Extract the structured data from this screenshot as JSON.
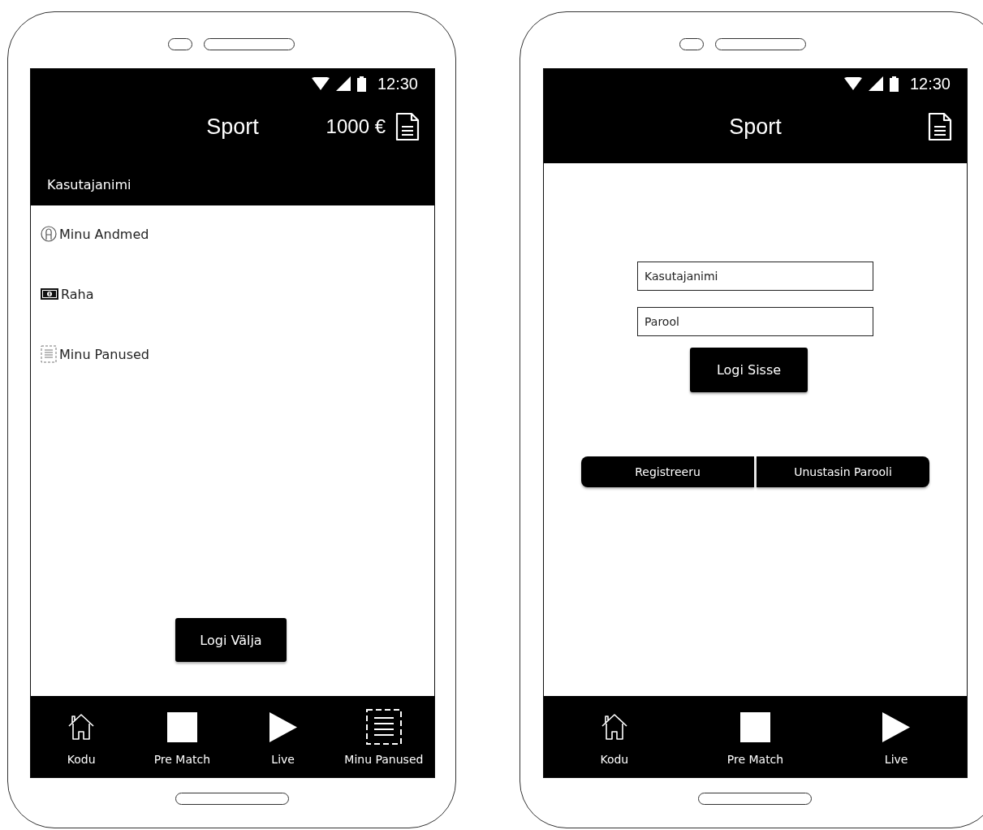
{
  "phones": [
    {
      "kind": "menu",
      "status_bar": {
        "time": "12:30"
      },
      "app_bar": {
        "title": "Sport",
        "balance": "1000 €"
      },
      "username": "Kasutajanimi",
      "menu_items": [
        {
          "kind": "profile",
          "label": "Minu Andmed"
        },
        {
          "kind": "money",
          "label": "Raha"
        },
        {
          "kind": "bets",
          "label": "Minu Panused"
        }
      ],
      "logout_button": "Logi Välja",
      "bottom_nav": [
        {
          "kind": "home",
          "label": "Kodu"
        },
        {
          "kind": "square",
          "label": "Pre Match"
        },
        {
          "kind": "play",
          "label": "Live"
        },
        {
          "kind": "list",
          "label": "Minu Panused"
        }
      ]
    },
    {
      "kind": "login",
      "status_bar": {
        "time": "12:30"
      },
      "app_bar": {
        "title": "Sport"
      },
      "fields": [
        {
          "placeholder": "Kasutajanimi"
        },
        {
          "placeholder": "Parool"
        }
      ],
      "login_button": "Logi Sisse",
      "button_pair": [
        "Registreeru",
        "Unustasin Parooli"
      ],
      "bottom_nav": [
        {
          "kind": "home",
          "label": "Kodu"
        },
        {
          "kind": "square",
          "label": "Pre Match"
        },
        {
          "kind": "play",
          "label": "Live"
        }
      ]
    }
  ]
}
